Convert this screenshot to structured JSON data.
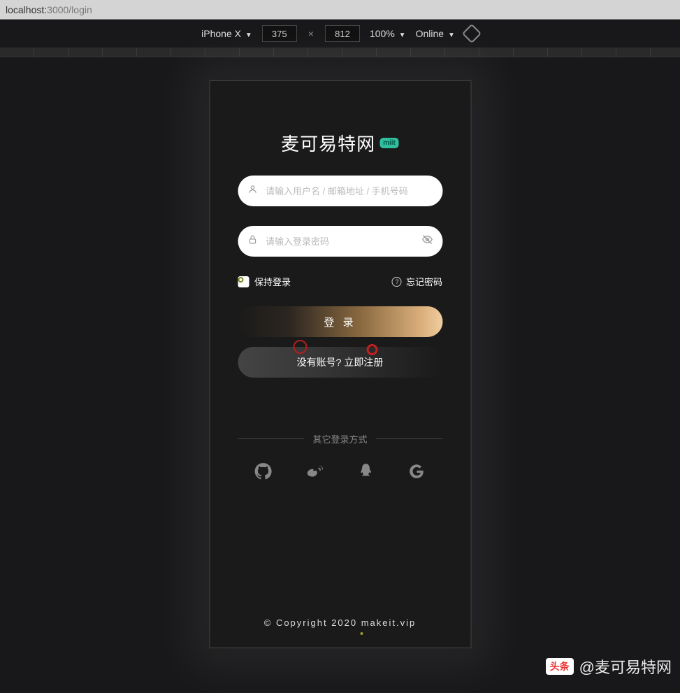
{
  "url": {
    "host": "localhost:",
    "port_path": "3000/login"
  },
  "devtools": {
    "device": "iPhone X",
    "width": "375",
    "height": "812",
    "zoom": "100%",
    "network": "Online"
  },
  "login": {
    "title": "麦可易特网",
    "badge": "miit",
    "username_placeholder": "请输入用户名 / 邮箱地址 / 手机号码",
    "password_placeholder": "请输入登录密码",
    "keep_logged": "保持登录",
    "forgot": "忘记密码",
    "login_btn": "登 录",
    "register_btn": "没有账号? 立即注册",
    "other_login": "其它登录方式",
    "social": [
      "github",
      "weibo",
      "qq",
      "google"
    ],
    "copyright": "© Copyright 2020 makeit.vip"
  },
  "watermark": {
    "badge": "头条",
    "text": "@麦可易特网"
  }
}
